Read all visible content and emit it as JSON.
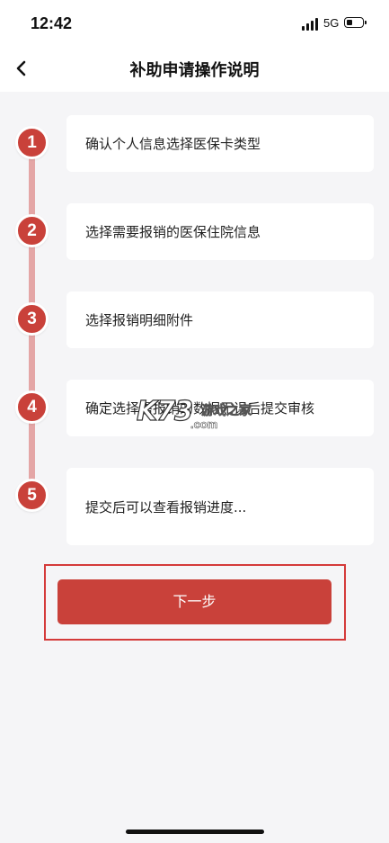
{
  "status_bar": {
    "time": "12:42",
    "network": "5G",
    "icons": [
      "signal-icon",
      "battery-icon"
    ]
  },
  "nav": {
    "title": "补助申请操作说明",
    "back_icon": "chevron-left-icon"
  },
  "steps": [
    {
      "number": "1",
      "text": "确认个人信息选择医保卡类型"
    },
    {
      "number": "2",
      "text": "选择需要报销的医保住院信息"
    },
    {
      "number": "3",
      "text": "选择报销明细附件"
    },
    {
      "number": "4",
      "text": "确定选择需报销的数据无误后提交审核"
    },
    {
      "number": "5",
      "text": "提交后可以查看报销进度..."
    }
  ],
  "watermark": {
    "brand": "K73",
    "cn": "游戏之家",
    "domain": ".com"
  },
  "next_button": {
    "label": "下一步"
  },
  "colors": {
    "accent": "#c9413a",
    "timeline": "#e4a6a6",
    "highlight_border": "#d43a3a",
    "background": "#f5f5f7"
  }
}
